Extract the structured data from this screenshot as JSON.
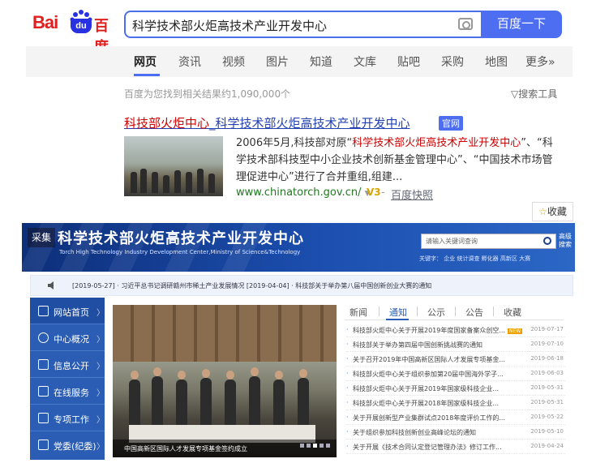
{
  "search": {
    "logo_text": "Bai",
    "logo_du": "du",
    "logo_cn": "百度",
    "query": "科学技术部火炬高技术产业开发中心",
    "button_label": "百度一下"
  },
  "tabs": [
    "网页",
    "资讯",
    "视频",
    "图片",
    "知道",
    "文库",
    "贴吧",
    "采购",
    "地图",
    "更多»"
  ],
  "result_stats": "百度为您找到相关结果约1,090,000个",
  "search_tools": "搜索工具",
  "result": {
    "title_a": "科技部火炬中心",
    "title_b": "_科学技术部火炬高技术产业开发中心",
    "official_badge": "官网",
    "snippet_1": "2006年5月,科技部对原“",
    "snippet_em": "科学技术部火炬高技术产业开发中心",
    "snippet_2": "”、“科学技术部科技型中小企业技术创新基金管理中心”、“中国技术市场管理促进中心”进行了合并重组,组建...",
    "url": "www.chinatorch.gov.cn/",
    "v3": "V3",
    "snapshot": "百度快照"
  },
  "collect_label": "收藏",
  "site": {
    "tag": "采集",
    "title": "科学技术部火炬高技术产业开发中心",
    "subtitle": "Torch High Technology Industry Development Center,Ministry of Science&Technology",
    "search_placeholder": "请输入关键词查询",
    "adv_line1": "高级",
    "adv_line2": "搜索",
    "hot_words": "关键字：  企业    统计调查    孵化器    高新区    大赛",
    "notice": "[2019-05-27] · 习近平总书记调研赣州市稀土产业发展情况  [2019-04-04] · 科技部关于举办第八届中国创新创业大赛的通知",
    "nav": [
      "网站首页",
      "中心概况",
      "信息公开",
      "在线服务",
      "专项工作",
      "党委(纪委)"
    ],
    "photo_caption": "中国高新区国际人才发展专项基金签约成立",
    "news_tabs": [
      "新闻",
      "通知",
      "公示",
      "公告",
      "收藏"
    ],
    "news": [
      {
        "title": "科技部火炬中心关于开展2019年度国家备案众创空...",
        "date": "2019-07-17",
        "badge": "NEW"
      },
      {
        "title": "科技部关于举办第四届中国创新挑战赛的通知",
        "date": "2019-07-10"
      },
      {
        "title": "关于召开2019年中国高新区国际人才发展专项基金...",
        "date": "2019-06-18"
      },
      {
        "title": "科技部火炬中心关于组织参加第20届中国海外学子...",
        "date": "2019-06-03"
      },
      {
        "title": "科技部火炬中心关于开展2019年国家级科技企业...",
        "date": "2019-05-31"
      },
      {
        "title": "科技部火炬中心关于开展2018年国家级科技企业...",
        "date": "2019-05-31"
      },
      {
        "title": "关于开展创新型产业集群试点2018年度评价工作的...",
        "date": "2019-05-22"
      },
      {
        "title": "关于组织参加科技创新创业高峰论坛的通知",
        "date": "2019-05-10"
      },
      {
        "title": "关于开展《技术合同认定登记管理办法》修订工作...",
        "date": "2019-04-24"
      }
    ]
  }
}
